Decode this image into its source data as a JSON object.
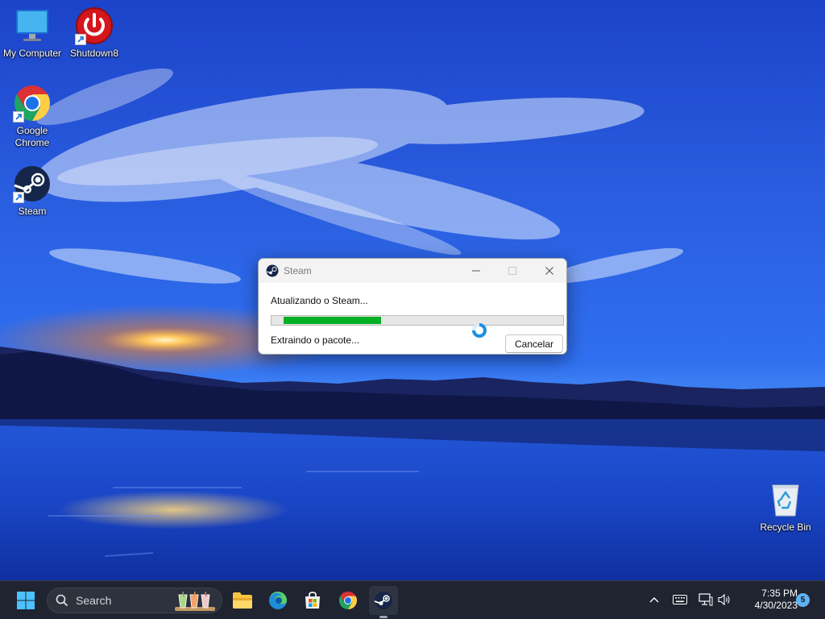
{
  "desktop": {
    "icons": [
      {
        "label": "My Computer"
      },
      {
        "label": "Shutdown8"
      },
      {
        "label": "Google\nChrome"
      },
      {
        "label": "Steam"
      },
      {
        "label": "Recycle Bin"
      }
    ]
  },
  "dialog": {
    "title": "Steam",
    "status": "Atualizando o Steam...",
    "substatus": "Extraindo o pacote...",
    "cancel_label": "Cancelar",
    "progress": 0.35
  },
  "taskbar": {
    "search_placeholder": "Search",
    "apps": [
      "File Explorer",
      "Microsoft Edge",
      "Microsoft Store",
      "Google Chrome",
      "Steam"
    ],
    "clock_time": "7:35 PM",
    "clock_date": "4/30/2023",
    "notification_count": "5"
  },
  "colors": {
    "progress_fill": "#06b025",
    "accent": "#0078d4",
    "taskbar_bg": "#1f2430"
  }
}
